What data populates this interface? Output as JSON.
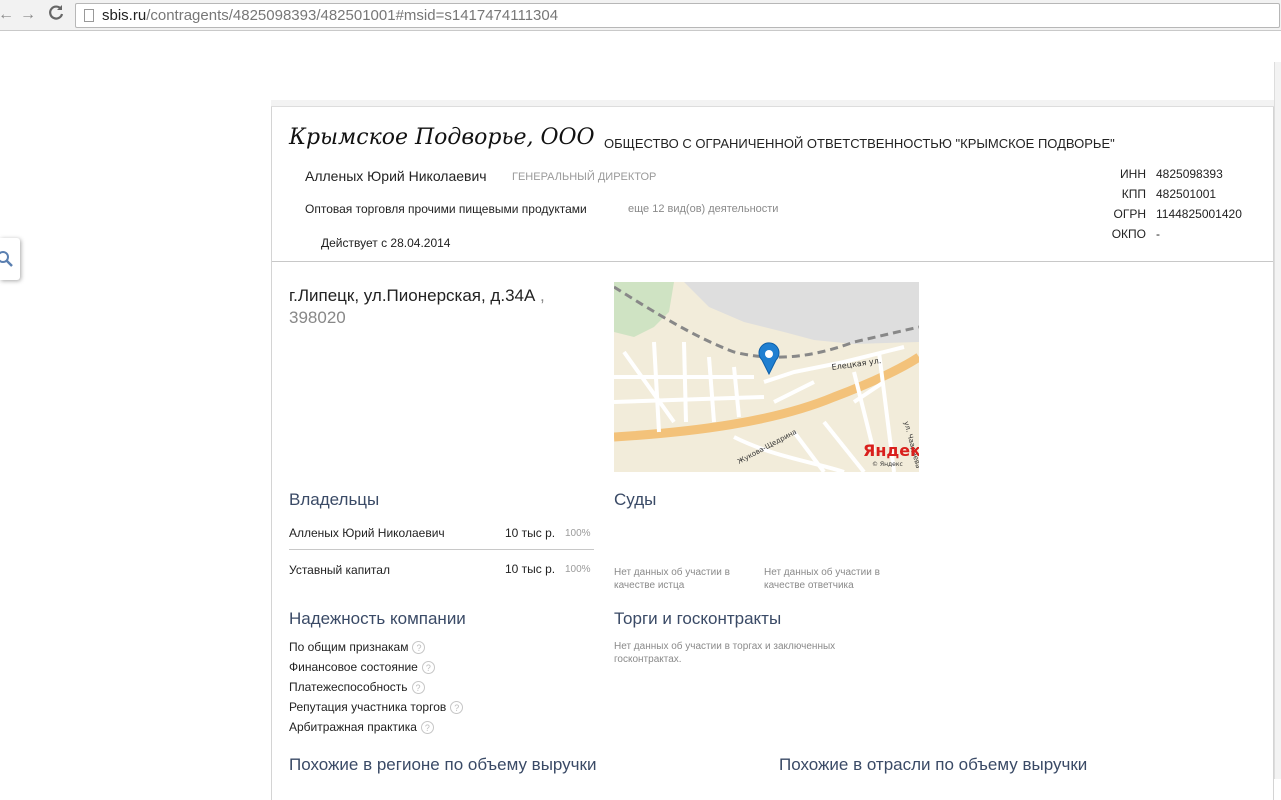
{
  "browser": {
    "url_host": "sbis.ru",
    "url_path": "/contragents/4825098393/482501001#msid=s1417474111304"
  },
  "company": {
    "short_name": "Крымское Подворье, ООО",
    "full_name": "ОБЩЕСТВО С ОГРАНИЧЕННОЙ ОТВЕТСТВЕННОСТЬЮ \"КРЫМСКОЕ ПОДВОРЬЕ\"",
    "director_name": "Алленых Юрий Николаевич",
    "director_role": "ГЕНЕРАЛЬНЫЙ ДИРЕКТОР",
    "activity": "Оптовая торговля прочими пищевыми продуктами",
    "activity_more": "еще 12 вид(ов) деятельности",
    "status": "Действует с 28.04.2014"
  },
  "requisites": [
    {
      "label": "ИНН",
      "value": "4825098393"
    },
    {
      "label": "КПП",
      "value": "482501001"
    },
    {
      "label": "ОГРН",
      "value": "1144825001420"
    },
    {
      "label": "ОКПО",
      "value": "-"
    }
  ],
  "address": {
    "street": "г.Липецк, ул.Пионерская, д.34А",
    "separator": " ,",
    "zip": "398020"
  },
  "map": {
    "street1": "Елецкая ул.",
    "street2": "ул. Чаадаева",
    "street3": "Жукова-Щедрина",
    "logo": "Яндекс",
    "copyright": "© Яндекс"
  },
  "owners": {
    "title": "Владельцы",
    "rows": [
      {
        "name": "Алленых Юрий Николаевич",
        "amount": "10 тыс р.",
        "pct": "100%"
      },
      {
        "name": "Уставный капитал",
        "amount": "10 тыс р.",
        "pct": "100%"
      }
    ]
  },
  "courts": {
    "title": "Суды",
    "plaintiff": "Нет данных об участии в качестве истца",
    "defendant": "Нет данных об участии в качестве ответчика"
  },
  "reliability": {
    "title": "Надежность компании",
    "items": [
      "По общим признакам",
      "Финансовое состояние",
      "Платежеспособность",
      "Репутация участника торгов",
      "Арбитражная практика"
    ],
    "help": "?"
  },
  "tenders": {
    "title": "Торги и госконтракты",
    "nodata": "Нет данных об участии в торгах и заключенных госконтрактах."
  },
  "similar": {
    "region_title": "Похожие в регионе по объему выручки",
    "industry_title": "Похожие в отрасли по объему выручки"
  }
}
